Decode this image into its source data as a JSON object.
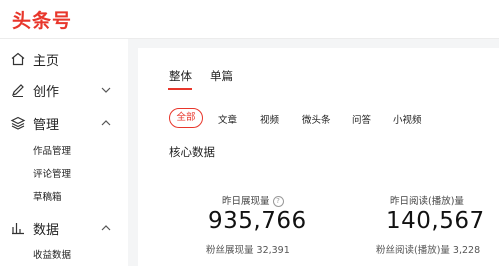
{
  "header": {
    "logo": "头条号"
  },
  "sidebar": {
    "items": [
      {
        "label": "主页",
        "icon": "home-icon"
      },
      {
        "label": "创作",
        "icon": "pen-icon",
        "expand": "chevron-down-icon"
      },
      {
        "label": "管理",
        "icon": "layers-icon",
        "expand": "chevron-up-icon",
        "children": [
          "作品管理",
          "评论管理",
          "草稿箱"
        ]
      },
      {
        "label": "数据",
        "icon": "bar-chart-icon",
        "expand": "chevron-up-icon",
        "children": [
          "收益数据"
        ]
      }
    ]
  },
  "main": {
    "tabs": [
      "整体",
      "单篇"
    ],
    "active_tab": "整体",
    "filters": [
      "全部",
      "文章",
      "视频",
      "微头条",
      "问答",
      "小视频"
    ],
    "active_filter": "全部",
    "section_title": "核心数据",
    "stats": [
      {
        "label": "昨日展现量",
        "value": "935,766",
        "sub": "粉丝展现量 32,391"
      },
      {
        "label": "昨日阅读(播放)量",
        "value": "140,567",
        "sub": "粉丝阅读(播放)量 3,228"
      }
    ]
  },
  "colors": {
    "accent": "#e8362b",
    "background": "#f4f5f6"
  }
}
